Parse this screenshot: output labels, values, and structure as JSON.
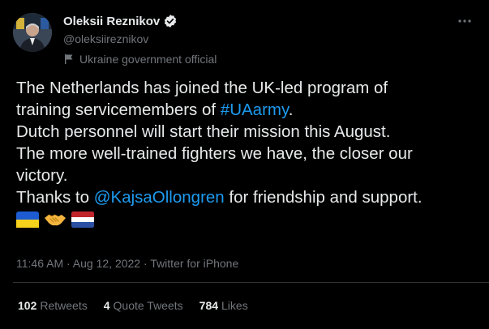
{
  "author": {
    "display_name": "Oleksii Reznikov",
    "handle": "@oleksiireznikov",
    "label": "Ukraine government official",
    "verified_color": "#e7e9ea"
  },
  "tweet": {
    "lines": [
      {
        "parts": [
          {
            "text": "The Netherlands has joined the UK-led program of"
          }
        ]
      },
      {
        "parts": [
          {
            "text": "training servicemembers of "
          },
          {
            "text": "#UAarmy",
            "link": true
          },
          {
            "text": "."
          }
        ]
      },
      {
        "parts": [
          {
            "text": "Dutch personnel will start their mission this August."
          }
        ]
      },
      {
        "parts": [
          {
            "text": "The more well-trained fighters we have, the closer our"
          }
        ]
      },
      {
        "parts": [
          {
            "text": "victory."
          }
        ]
      },
      {
        "parts": [
          {
            "text": "Thanks to "
          },
          {
            "text": "@KajsaOllongren",
            "link": true
          },
          {
            "text": " for friendship and support."
          }
        ]
      }
    ],
    "emojis": [
      "flag-ukraine-icon",
      "handshake-icon",
      "flag-netherlands-icon"
    ]
  },
  "meta": {
    "time": "11:46 AM",
    "separator": " · ",
    "date": "Aug 12, 2022",
    "source": "Twitter for iPhone"
  },
  "stats": {
    "retweets": {
      "count": "102",
      "label": "Retweets"
    },
    "quotes": {
      "count": "4",
      "label": "Quote Tweets"
    },
    "likes": {
      "count": "784",
      "label": "Likes"
    }
  },
  "colors": {
    "background": "#000000",
    "text": "#e7e9ea",
    "secondary": "#71767b",
    "link": "#1d9bf0",
    "divider": "#2f3336"
  }
}
